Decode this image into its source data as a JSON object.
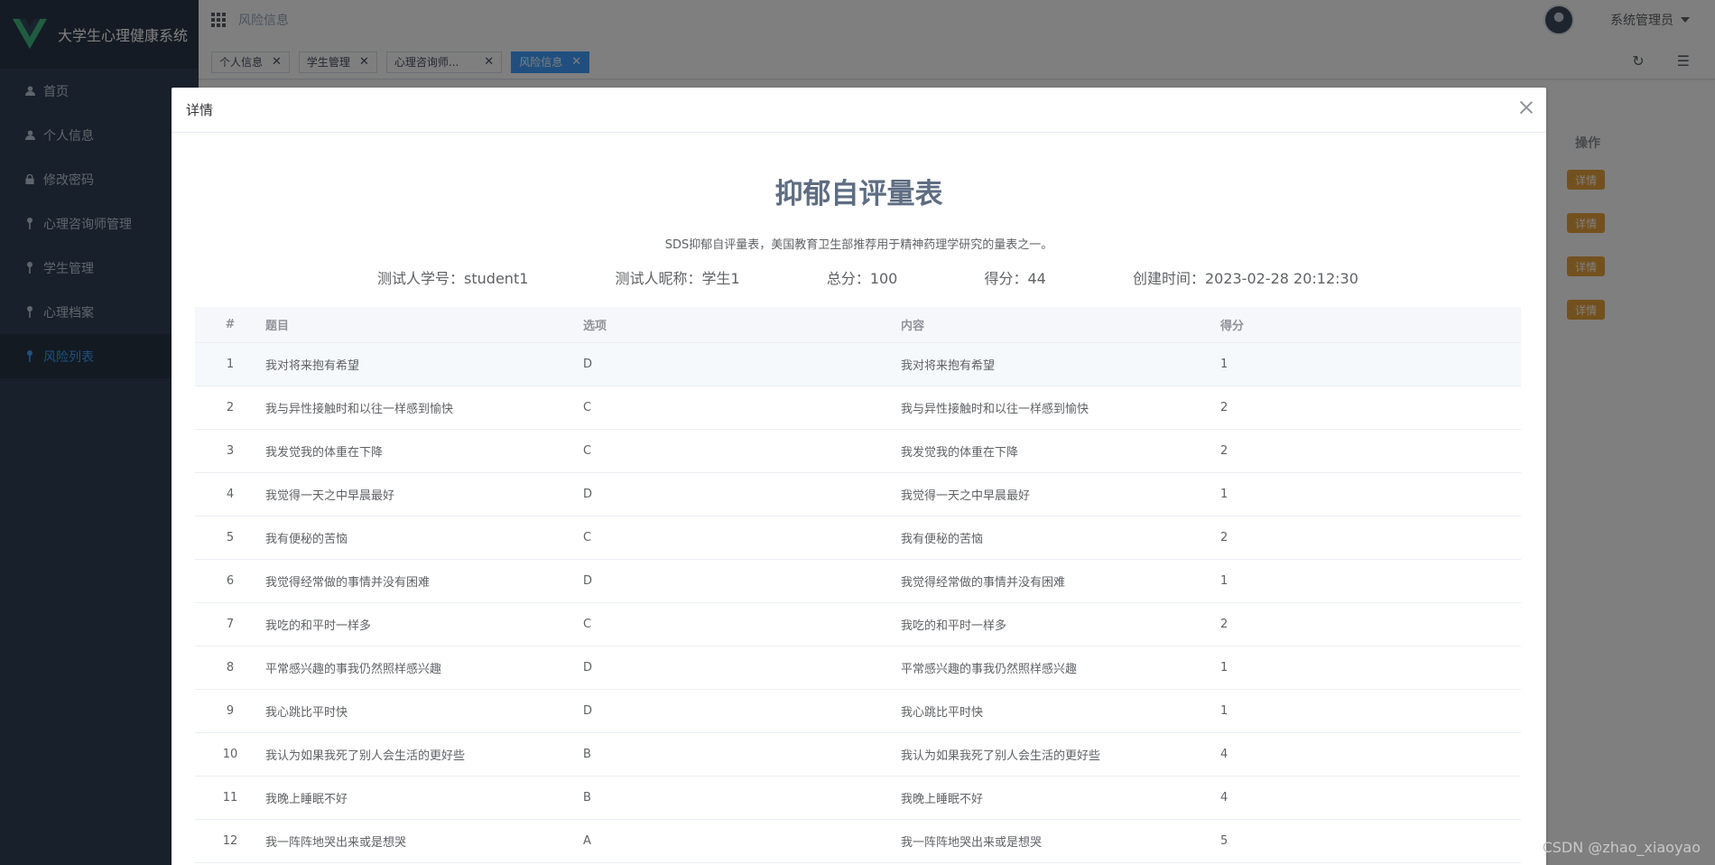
{
  "app": {
    "title": "大学生心理健康系统"
  },
  "sidebar": {
    "items": [
      {
        "label": "首页",
        "icon": "user-icon",
        "active": false
      },
      {
        "label": "个人信息",
        "icon": "user-icon",
        "active": false
      },
      {
        "label": "修改密码",
        "icon": "lock-icon",
        "active": false
      },
      {
        "label": "心理咨询师管理",
        "icon": "pin-icon",
        "active": false
      },
      {
        "label": "学生管理",
        "icon": "pin-icon",
        "active": false
      },
      {
        "label": "心理档案",
        "icon": "pin-icon",
        "active": false
      },
      {
        "label": "风险列表",
        "icon": "pin-icon",
        "active": true
      }
    ]
  },
  "header": {
    "breadcrumb": "风险信息",
    "user": "系统管理员"
  },
  "tags": [
    {
      "label": "个人信息",
      "active": false
    },
    {
      "label": "学生管理",
      "active": false
    },
    {
      "label": "心理咨询师...",
      "active": false
    },
    {
      "label": "风险信息",
      "active": true
    }
  ],
  "page": {
    "op_header": "操作",
    "detail_btn": "详情"
  },
  "dialog": {
    "title": "详情",
    "scale_title": "抑郁自评量表",
    "scale_desc": "SDS抑郁自评量表，美国教育卫生部推荐用于精神药理学研究的量表之一。",
    "meta": {
      "student_id": "测试人学号：student1",
      "nickname": "测试人昵称：学生1",
      "total": "总分：100",
      "score": "得分：44",
      "created": "创建时间：2023-02-28 20:12:30"
    },
    "table": {
      "headers": [
        "#",
        "题目",
        "选项",
        "内容",
        "得分"
      ],
      "rows": [
        [
          "1",
          "我对将来抱有希望",
          "D",
          "我对将来抱有希望",
          "1"
        ],
        [
          "2",
          "我与异性接触时和以往一样感到愉快",
          "C",
          "我与异性接触时和以往一样感到愉快",
          "2"
        ],
        [
          "3",
          "我发觉我的体重在下降",
          "C",
          "我发觉我的体重在下降",
          "2"
        ],
        [
          "4",
          "我觉得一天之中早晨最好",
          "D",
          "我觉得一天之中早晨最好",
          "1"
        ],
        [
          "5",
          "我有便秘的苦恼",
          "C",
          "我有便秘的苦恼",
          "2"
        ],
        [
          "6",
          "我觉得经常做的事情并没有困难",
          "D",
          "我觉得经常做的事情并没有困难",
          "1"
        ],
        [
          "7",
          "我吃的和平时一样多",
          "C",
          "我吃的和平时一样多",
          "2"
        ],
        [
          "8",
          "平常感兴趣的事我仍然照样感兴趣",
          "D",
          "平常感兴趣的事我仍然照样感兴趣",
          "1"
        ],
        [
          "9",
          "我心跳比平时快",
          "D",
          "我心跳比平时快",
          "1"
        ],
        [
          "10",
          "我认为如果我死了别人会生活的更好些",
          "B",
          "我认为如果我死了别人会生活的更好些",
          "4"
        ],
        [
          "11",
          "我晚上睡眠不好",
          "B",
          "我晚上睡眠不好",
          "4"
        ],
        [
          "12",
          "我一阵阵地哭出来或是想哭",
          "A",
          "我一阵阵地哭出来或是想哭",
          "5"
        ]
      ]
    }
  },
  "watermark": "CSDN @zhao_xiaoyao",
  "colors": {
    "accent": "#409eff",
    "sidebar": "#304156",
    "warning": "#e6a23c"
  }
}
